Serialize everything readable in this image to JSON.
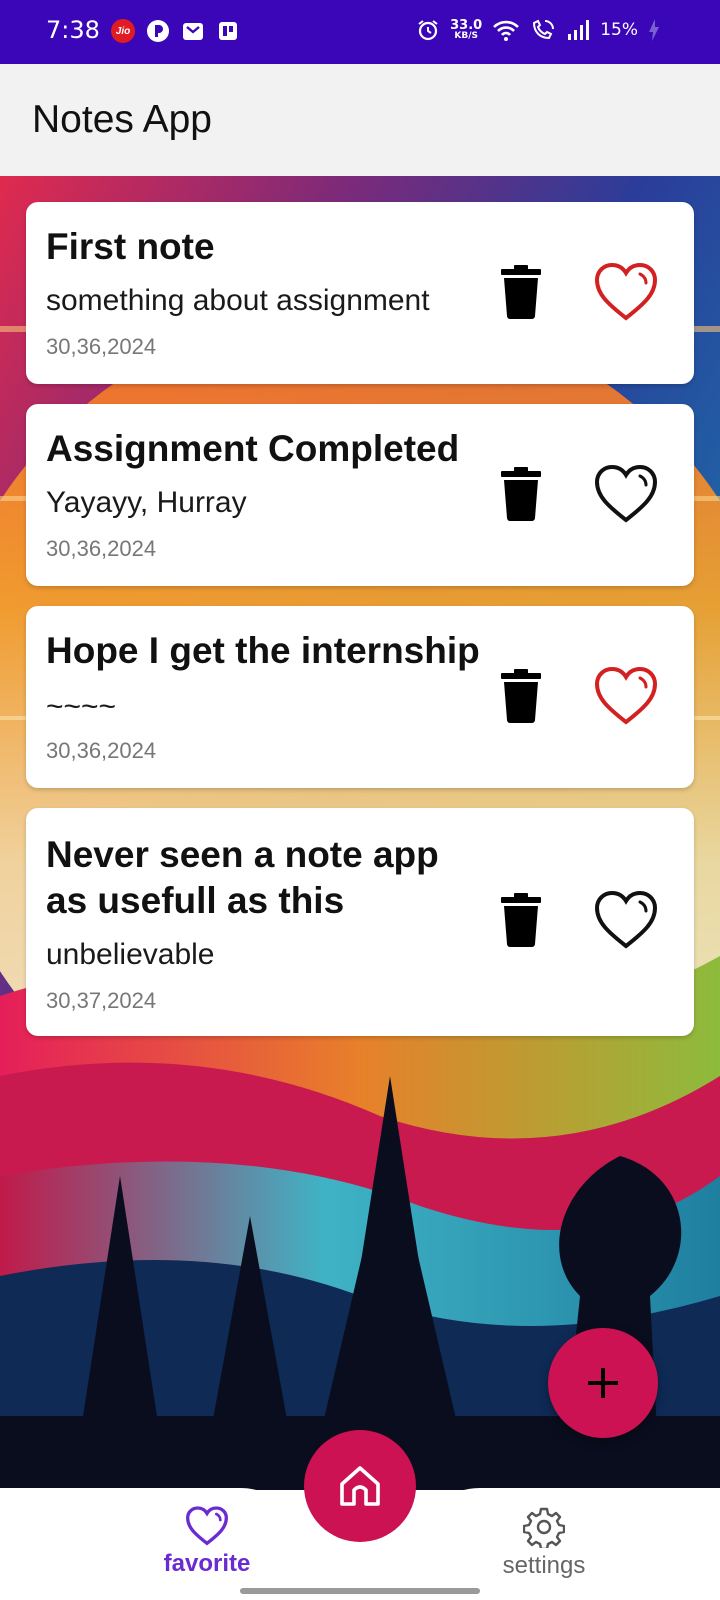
{
  "status_bar": {
    "time": "7:38",
    "carrier_icon_text": "Jio",
    "net_speed_value": "33.0",
    "net_speed_unit": "KB/S",
    "battery": "15%",
    "background_color": "#3a06b8"
  },
  "app_bar": {
    "title": "Notes App"
  },
  "notes": [
    {
      "title": "First note",
      "body": "something about assignment",
      "date": "30,36,2024",
      "favorite": true
    },
    {
      "title": "Assignment Completed",
      "body": "Yayayy, Hurray",
      "date": "30,36,2024",
      "favorite": false
    },
    {
      "title": "Hope I get the internship",
      "body": "~~~~",
      "date": "30,36,2024",
      "favorite": true
    },
    {
      "title": "Never seen a note app as usefull as this",
      "body": "unbelievable",
      "date": "30,37,2024",
      "favorite": false
    }
  ],
  "icons": {
    "delete": "trash-icon",
    "favorite": "heart-icon",
    "add": "plus-icon",
    "home": "home-icon",
    "settings": "gear-icon"
  },
  "bottom_nav": {
    "items": [
      {
        "label": "favorite",
        "active": true
      },
      {
        "label": "settings",
        "active": false
      }
    ]
  },
  "colors": {
    "accent": "#cc1253",
    "favorite_active": "#d32020",
    "nav_active": "#6a2bd1"
  }
}
